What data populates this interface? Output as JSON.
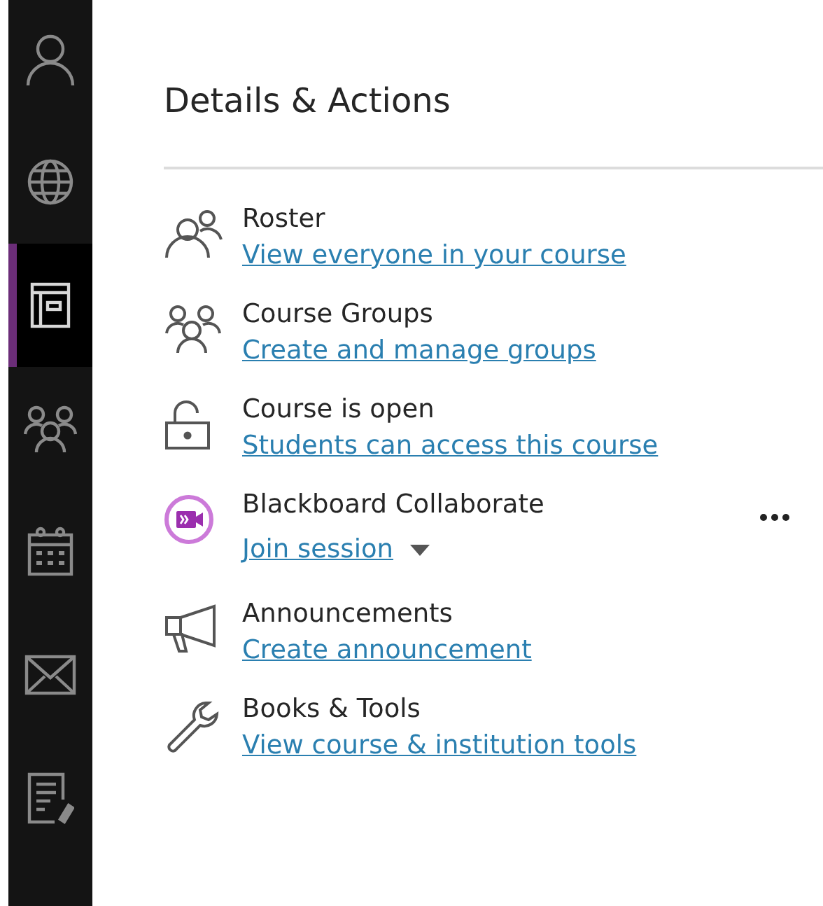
{
  "sidebar": {
    "items": [
      {
        "kind": "person",
        "selected": false
      },
      {
        "kind": "globe",
        "selected": false
      },
      {
        "kind": "course",
        "selected": true
      },
      {
        "kind": "groups",
        "selected": false
      },
      {
        "kind": "calendar",
        "selected": false
      },
      {
        "kind": "mail",
        "selected": false
      },
      {
        "kind": "grades",
        "selected": false
      }
    ]
  },
  "panel": {
    "title": "Details & Actions",
    "rows": [
      {
        "kind": "roster",
        "title": "Roster",
        "link": "View everyone in your course"
      },
      {
        "kind": "groups",
        "title": "Course Groups",
        "link": "Create and manage groups"
      },
      {
        "kind": "lock",
        "title": "Course is open",
        "link": "Students can access this course"
      },
      {
        "kind": "collaborate",
        "title": "Blackboard Collaborate",
        "link": "Join session",
        "dropdown": true,
        "more_menu": true
      },
      {
        "kind": "announcement",
        "title": "Announcements",
        "link": "Create announcement"
      },
      {
        "kind": "tools",
        "title": "Books & Tools",
        "link": "View course & institution tools"
      }
    ]
  }
}
